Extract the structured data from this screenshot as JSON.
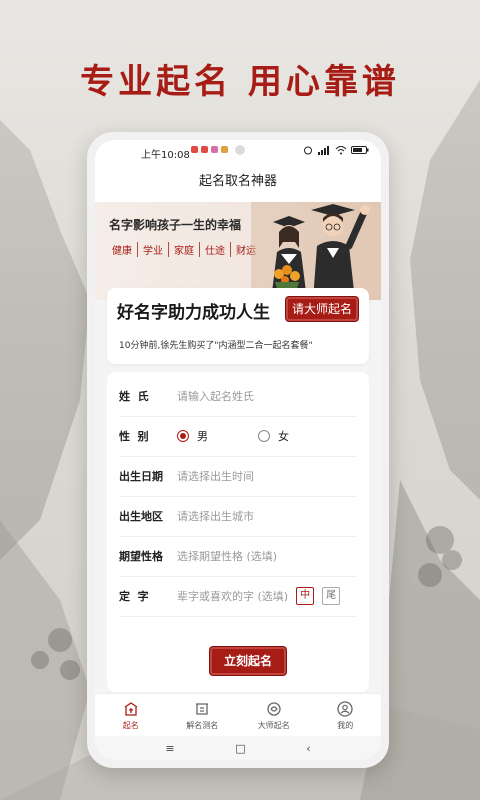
{
  "headline": "专业起名 用心靠谱",
  "status_bar": {
    "time": "上午10:08"
  },
  "app_title": "起名取名神器",
  "banner": {
    "slogan": "名字影响孩子一生的幸福",
    "tags": [
      "健康",
      "学业",
      "家庭",
      "仕途",
      "财运"
    ]
  },
  "promo": {
    "title": "好名字助力成功人生",
    "button": "请大师起名",
    "note": "10分钟前,徐先生购买了\"内涵型二合一起名套餐\""
  },
  "form": {
    "surname": {
      "label": "姓  氏",
      "placeholder": "请输入起名姓氏"
    },
    "gender": {
      "label": "性  别",
      "options": [
        "男",
        "女"
      ],
      "selected": "男"
    },
    "birth_date": {
      "label": "出生日期",
      "placeholder": "请选择出生时间"
    },
    "birth_place": {
      "label": "出生地区",
      "placeholder": "请选择出生城市"
    },
    "personality": {
      "label": "期望性格",
      "placeholder": "选择期望性格 (选填)"
    },
    "fixed_char": {
      "label": "定  字",
      "placeholder": "辈字或喜欢的字 (选填)",
      "positions": [
        "中",
        "尾"
      ],
      "selected": "中"
    },
    "submit": "立刻起名"
  },
  "tabs": [
    {
      "label": "起名",
      "icon": "naming-icon",
      "active": true
    },
    {
      "label": "解名测名",
      "icon": "analysis-icon",
      "active": false
    },
    {
      "label": "大师起名",
      "icon": "master-icon",
      "active": false
    },
    {
      "label": "我的",
      "icon": "profile-icon",
      "active": false
    }
  ],
  "nav": {
    "menu": "≡",
    "home": "□",
    "back": "‹"
  },
  "colors": {
    "brand": "#a81c16",
    "background": "#f4f4f4"
  }
}
